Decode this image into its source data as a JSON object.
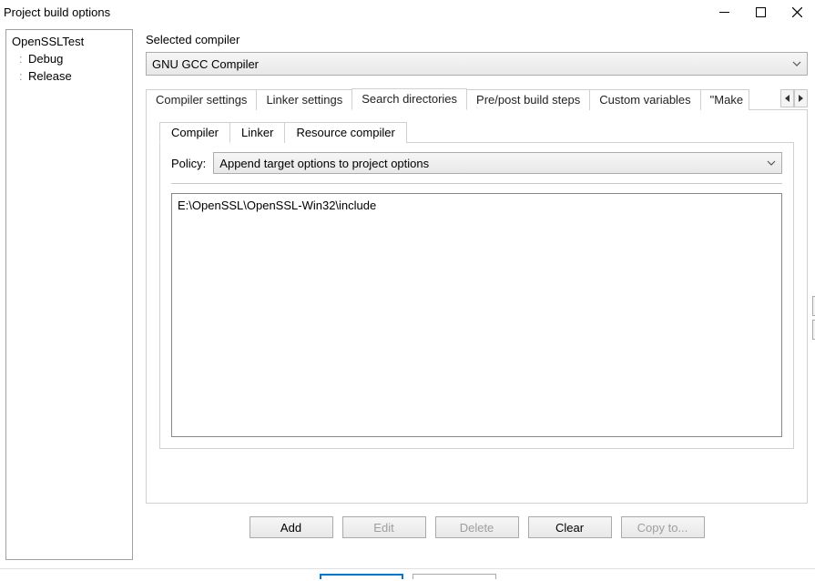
{
  "window": {
    "title": "Project build options"
  },
  "tree": {
    "root": "OpenSSLTest",
    "children": [
      "Debug",
      "Release"
    ]
  },
  "compiler": {
    "label": "Selected compiler",
    "value": "GNU GCC Compiler"
  },
  "tabs": {
    "items": [
      "Compiler settings",
      "Linker settings",
      "Search directories",
      "Pre/post build steps",
      "Custom variables",
      "\"Make"
    ],
    "active_index": 2
  },
  "subtabs": {
    "items": [
      "Compiler",
      "Linker",
      "Resource compiler"
    ],
    "active_index": 0
  },
  "policy": {
    "label": "Policy:",
    "value": "Append target options to project options"
  },
  "dirs": {
    "items": [
      "E:\\OpenSSL\\OpenSSL-Win32\\include"
    ]
  },
  "buttons": {
    "add": "Add",
    "edit": "Edit",
    "delete": "Delete",
    "clear": "Clear",
    "copy_to": "Copy to..."
  }
}
